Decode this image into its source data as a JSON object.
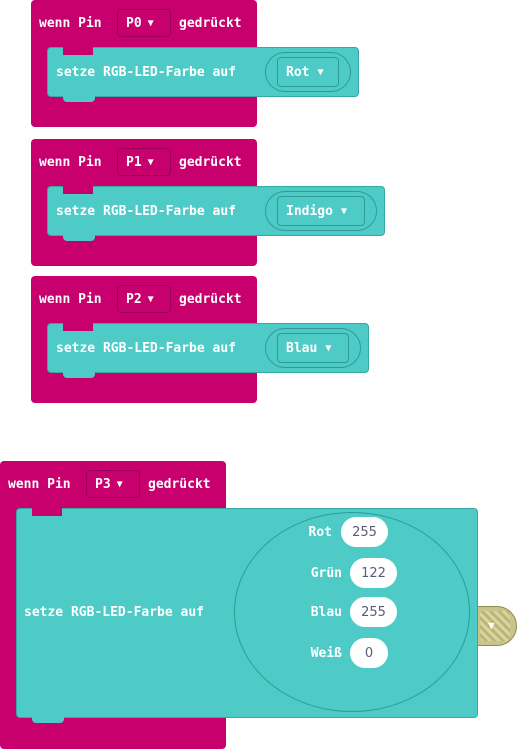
{
  "blocks": [
    {
      "event_prefix": "wenn Pin",
      "pin": "P0",
      "event_suffix": "gedrückt",
      "action": "setze RGB-LED-Farbe auf",
      "color": "Rot"
    },
    {
      "event_prefix": "wenn Pin",
      "pin": "P1",
      "event_suffix": "gedrückt",
      "action": "setze RGB-LED-Farbe auf",
      "color": "Indigo"
    },
    {
      "event_prefix": "wenn Pin",
      "pin": "P2",
      "event_suffix": "gedrückt",
      "action": "setze RGB-LED-Farbe auf",
      "color": "Blau"
    }
  ],
  "rgb_block": {
    "event_prefix": "wenn Pin",
    "pin": "P3",
    "event_suffix": "gedrückt",
    "action": "setze RGB-LED-Farbe auf",
    "fields": [
      {
        "label": "Rot",
        "value": "255"
      },
      {
        "label": "Grün",
        "value": "122"
      },
      {
        "label": "Blau",
        "value": "255"
      },
      {
        "label": "Weiß",
        "value": "0"
      }
    ]
  },
  "icons": {
    "dropdown": "chevron-down-icon"
  },
  "colors": {
    "event": "#c8006e",
    "action": "#4ecbc6"
  }
}
